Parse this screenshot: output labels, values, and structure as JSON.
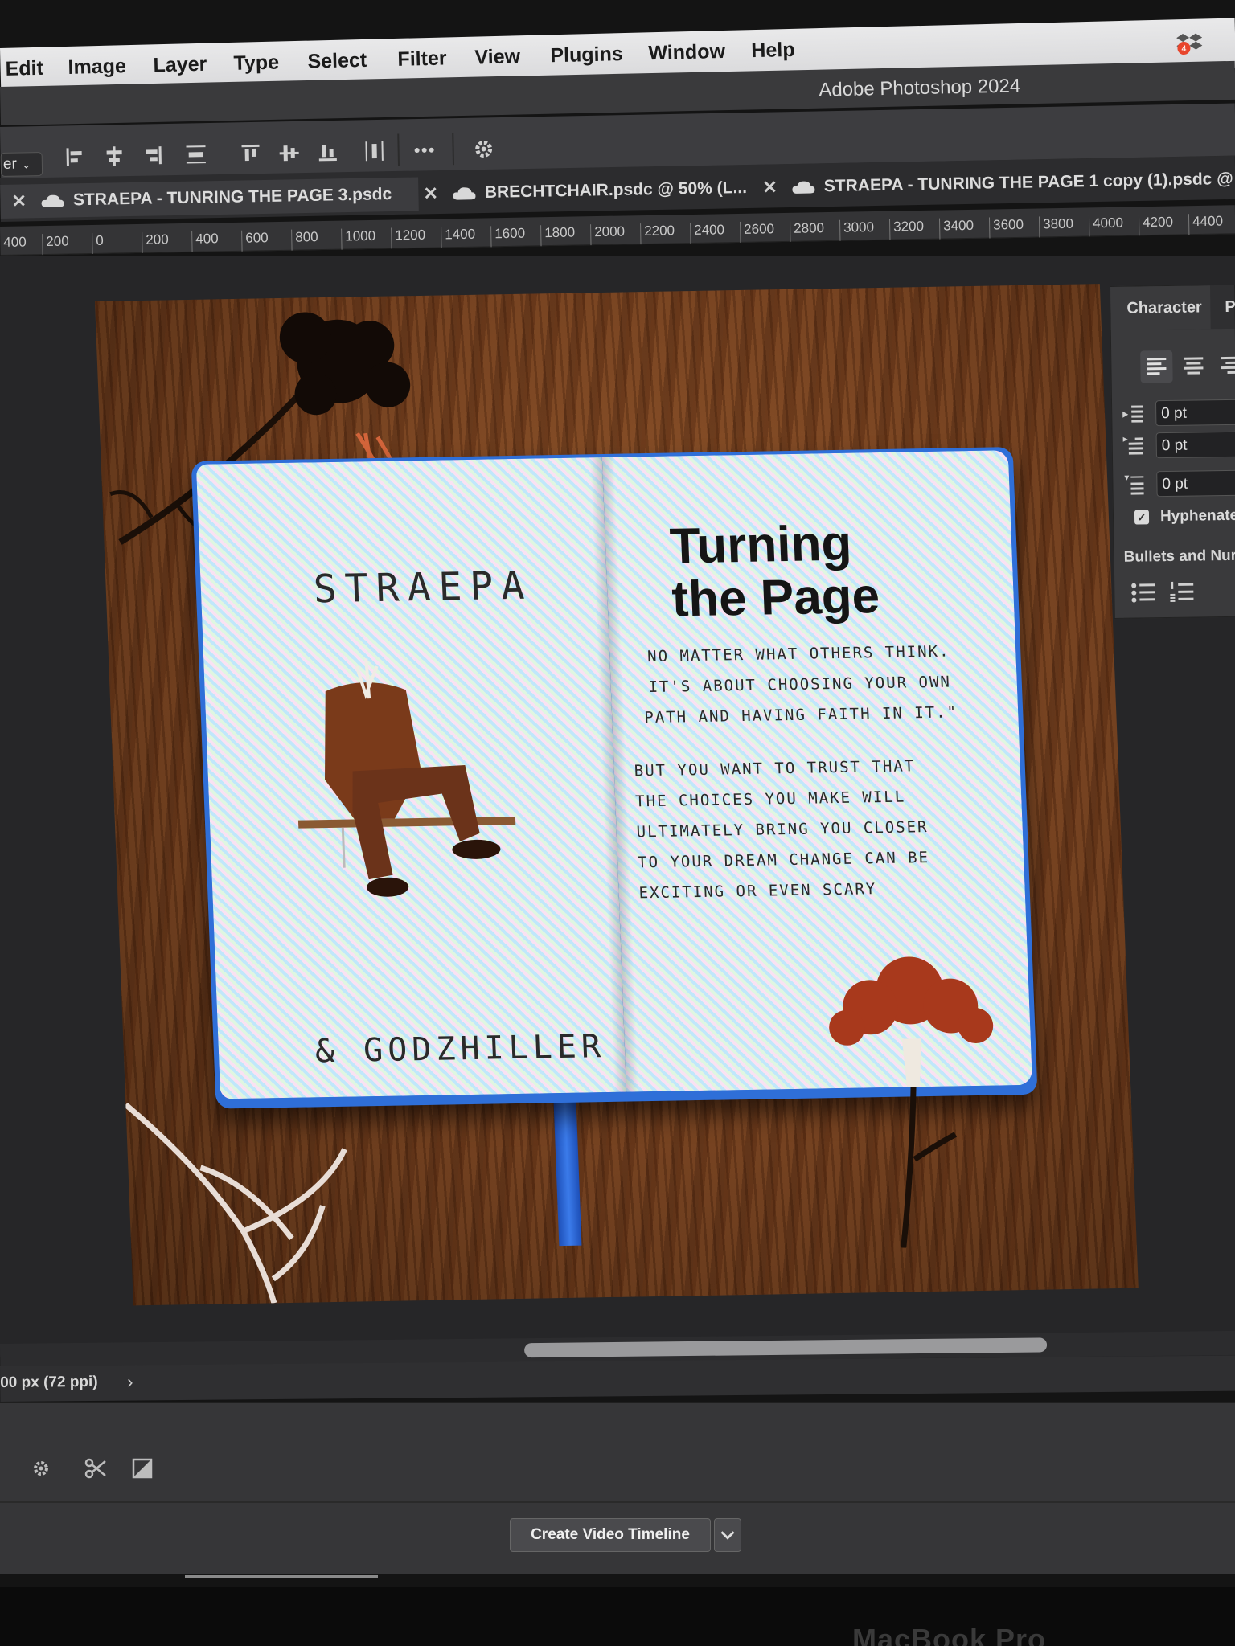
{
  "menu": {
    "items": [
      "Edit",
      "Image",
      "Layer",
      "Type",
      "Select",
      "Filter",
      "View",
      "Plugins",
      "Window",
      "Help"
    ],
    "badge_count": "4"
  },
  "title": {
    "app": "Adobe Photoshop 2024"
  },
  "options_bar": {
    "layer_select": "er"
  },
  "tabs": [
    {
      "label": "STRAEPA - TUNRING THE PAGE 3.psdc",
      "active": true
    },
    {
      "label": "BRECHTCHAIR.psdc @ 50% (L...",
      "active": false
    },
    {
      "label": "STRAEPA - TUNRING THE PAGE 1 copy (1).psdc @",
      "active": false
    }
  ],
  "ruler": [
    "400",
    "200",
    "0",
    "200",
    "400",
    "600",
    "800",
    "1000",
    "1200",
    "1400",
    "1600",
    "1800",
    "2000",
    "2200",
    "2400",
    "2600",
    "2800",
    "3000",
    "3200",
    "3400",
    "3600",
    "3800",
    "4000",
    "4200",
    "4400"
  ],
  "artwork": {
    "artist": "STRAEPA",
    "feature": "& GODZHILLER",
    "title_line1": "Turning",
    "title_line2": "the Page",
    "quote": "NO MATTER WHAT OTHERS THINK. IT'S ABOUT CHOOSING YOUR OWN PATH AND HAVING FAITH IN IT.\"",
    "body": "BUT YOU WANT TO TRUST THAT THE CHOICES YOU MAKE WILL ULTIMATELY BRING YOU CLOSER TO YOUR DREAM CHANGE CAN BE EXCITING OR EVEN SCARY"
  },
  "character_panel": {
    "tab_active": "Character",
    "tab_next": "P",
    "indent_left": "0 pt",
    "indent_first": "0 pt",
    "space_before": "0 pt",
    "hyphenate_label": "Hyphenate",
    "hyphenate_checked": true,
    "bullets_label": "Bullets and Nur"
  },
  "status": {
    "zoom_text": "00 px (72 ppi)",
    "chevron": "›"
  },
  "timeline": {
    "create_button": "Create Video Timeline"
  },
  "bezel": {
    "brand": "MacBook Pro"
  },
  "colors": {
    "menubar": "#e0e0e2",
    "panel": "#3a3a3c",
    "workspace": "#262628",
    "notebook_cover": "#2f6fd8",
    "wood": "#7a4220",
    "badge": "#e8452c"
  }
}
